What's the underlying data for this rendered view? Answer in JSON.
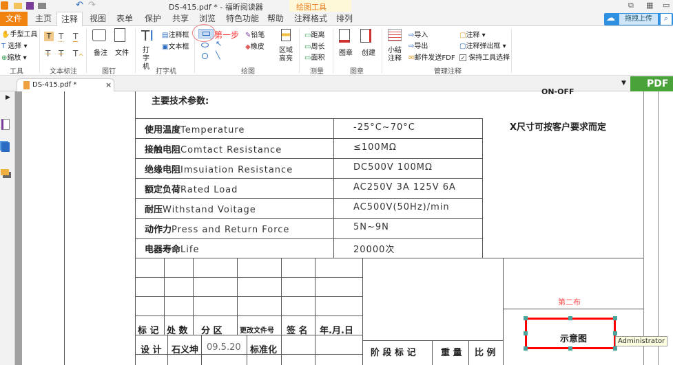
{
  "window": {
    "title": "DS-415.pdf * - 福昕阅读器",
    "context_tab": "绘图工具"
  },
  "tabs": [
    "文件",
    "主页",
    "注释",
    "视图",
    "表单",
    "保护",
    "共享",
    "浏览",
    "特色功能",
    "帮助",
    "注释格式",
    "排列"
  ],
  "upload_button": "拖拽上传",
  "ribbon": {
    "tools": {
      "hand": "手型工具",
      "select": "选择",
      "zoom": "缩放",
      "label": "工具"
    },
    "text_markup": {
      "label": "文本标注"
    },
    "pin": {
      "note": "备注",
      "file": "文件",
      "label": "图钉"
    },
    "typewriter": {
      "typewriter": "打字机",
      "callout": "注释框",
      "textbox": "文本框",
      "label": "打字机"
    },
    "drawing": {
      "annotation": "第一步",
      "pencil": "铅笔",
      "eraser": "橡皮",
      "area_highlight": "区域高亮",
      "label": "绘图"
    },
    "measure": {
      "distance": "距离",
      "perimeter": "周长",
      "area": "面积",
      "label": "测量"
    },
    "stamp": {
      "stamp": "图章",
      "create": "创建",
      "label": "图章"
    },
    "manage": {
      "summarize": "小结注释",
      "import": "导入",
      "export": "导出",
      "email": "邮件发送FDF",
      "comments": "注释",
      "popup": "注释弹出框",
      "keep_tool": "保持工具选择",
      "label": "管理注释"
    }
  },
  "doc_tab": "DS-415.pdf *",
  "pdf_badge": "PDF",
  "document": {
    "top_fragment": "ON-OFF",
    "heading": "主要技术参数:",
    "note": "X尺寸可按客户要求而定",
    "params": [
      {
        "cn": "使用温度",
        "en": "Temperature",
        "value": "-25°C~70°C"
      },
      {
        "cn": "接触电阻",
        "en": "Comtact Resistance",
        "value": "≤100MΩ"
      },
      {
        "cn": "绝缘电阻",
        "en": "Imsuiation Resistance",
        "value": "DC500V 100MΩ"
      },
      {
        "cn": "额定负荷",
        "en": "Rated Load",
        "value": "AC250V 3A 125V 6A"
      },
      {
        "cn": "耐压",
        "en": "Withstand Voitage",
        "value": "AC500V(50Hz)/min"
      },
      {
        "cn": "动作力",
        "en": "Press and Return Force",
        "value": "5N~9N"
      },
      {
        "cn": "电器寿命",
        "en": "Life",
        "value": "20000次"
      }
    ],
    "title_block": {
      "h1": "标 记",
      "h2": "处 数",
      "h3": "分 区",
      "h4": "更改文件号",
      "h5": "签 名",
      "h6": "年.月.日",
      "design": "设 计",
      "designer": "石义坤",
      "date": "09.5.20",
      "standard": "标准化",
      "stage": "阶 段 标 记",
      "weight": "重 量",
      "scale": "比 例"
    },
    "annotation_step2": "第二布",
    "rect_text": "示意图",
    "tooltip": "Administrator"
  },
  "colors": {
    "accent": "#f0820f",
    "annot": "#ff0000",
    "handle": "#4aa39a"
  }
}
